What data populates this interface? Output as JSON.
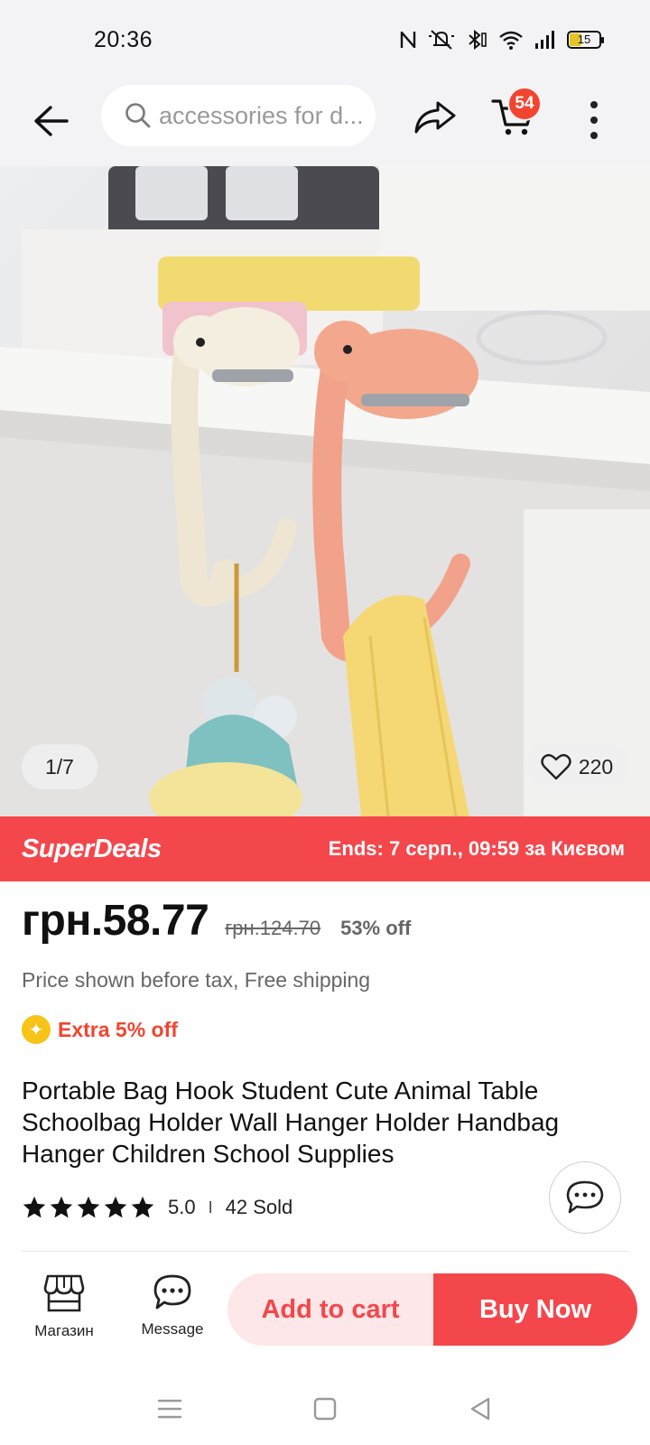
{
  "status_bar": {
    "time": "20:36",
    "battery": "15",
    "icons": [
      "nfc-icon",
      "mute-icon",
      "bluetooth-icon",
      "wifi-icon",
      "signal-icon",
      "battery-icon"
    ]
  },
  "nav": {
    "search_placeholder": "accessories for d...",
    "cart_count": "54"
  },
  "gallery": {
    "counter": "1/7",
    "wishlist_count": "220"
  },
  "superdeals": {
    "brand": "SuperDeals",
    "ends": "Ends: 7 серп., 09:59 за Києвом"
  },
  "price": {
    "current": "грн.58.77",
    "original": "грн.124.70",
    "discount": "53% off",
    "note": "Price shown before tax, Free shipping",
    "extra": "Extra 5% off"
  },
  "product": {
    "title": "Portable Bag Hook Student Cute Animal Table Schoolbag  Holder Wall Hanger Holder Handbag Hanger Children School Supplies",
    "rating": "5.0",
    "separator": "I",
    "sold": "42 Sold",
    "stars": 5
  },
  "actions": {
    "store_label": "Магазин",
    "message_label": "Message",
    "add_to_cart": "Add to cart",
    "buy_now": "Buy Now"
  },
  "colors": {
    "accent": "#f4474c",
    "badge": "#f2442f",
    "coin": "#f7c316"
  }
}
